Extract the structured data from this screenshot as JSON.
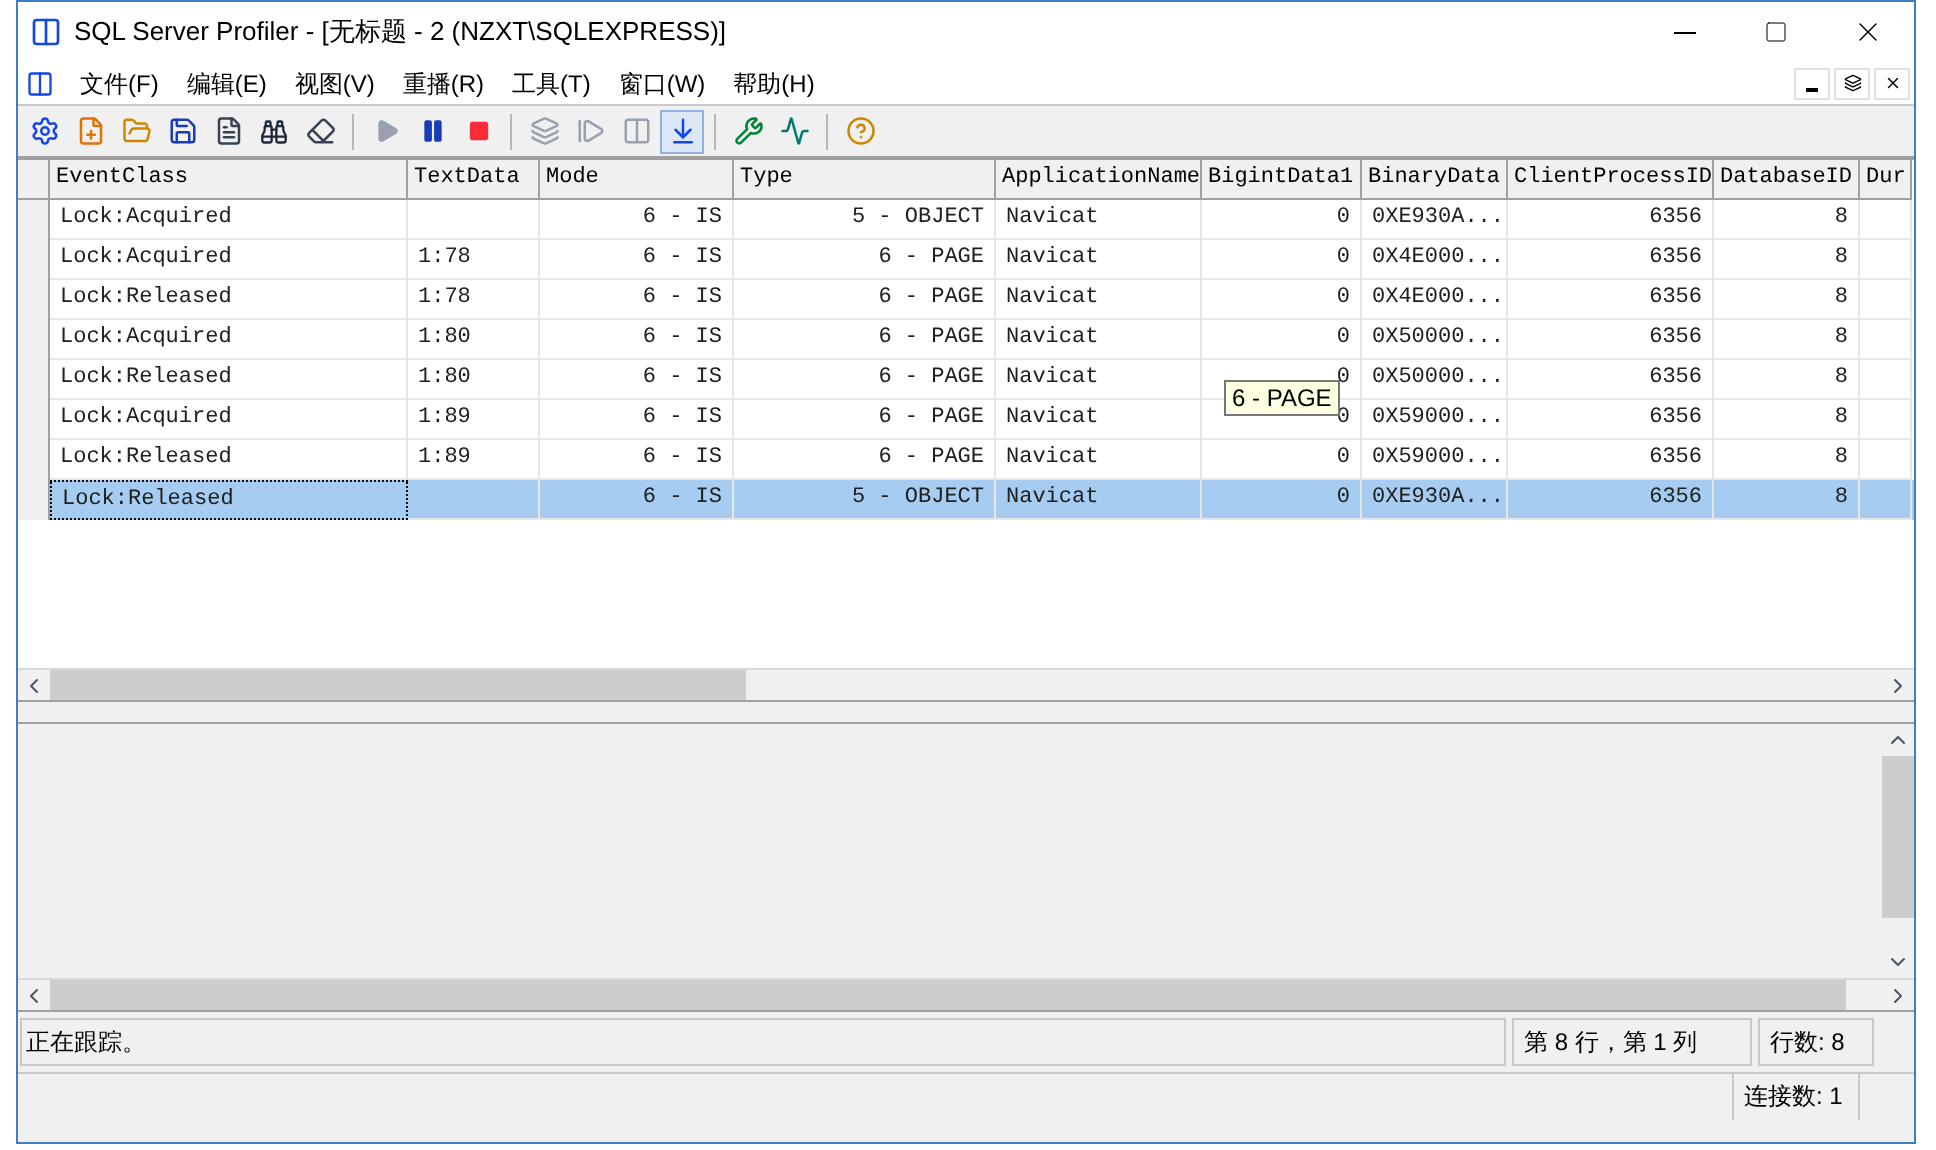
{
  "window": {
    "title": "SQL Server Profiler - [无标题 - 2 (NZXT\\SQLEXPRESS)]"
  },
  "menu": [
    "文件(F)",
    "编辑(E)",
    "视图(V)",
    "重播(R)",
    "工具(T)",
    "窗口(W)",
    "帮助(H)"
  ],
  "toolbar": [
    {
      "kind": "properties",
      "disabled": false,
      "selected": false
    },
    {
      "kind": "new",
      "disabled": false,
      "selected": false
    },
    {
      "kind": "open",
      "disabled": false,
      "selected": false
    },
    {
      "kind": "save",
      "disabled": false,
      "selected": false
    },
    {
      "kind": "template",
      "disabled": false,
      "selected": false
    },
    {
      "kind": "find",
      "disabled": false,
      "selected": false
    },
    {
      "kind": "clear",
      "disabled": false,
      "selected": false
    },
    {
      "kind": "sep"
    },
    {
      "kind": "play",
      "disabled": true,
      "selected": false
    },
    {
      "kind": "pause",
      "disabled": false,
      "selected": false
    },
    {
      "kind": "stop",
      "disabled": false,
      "selected": false
    },
    {
      "kind": "sep"
    },
    {
      "kind": "windows",
      "disabled": true,
      "selected": false
    },
    {
      "kind": "step",
      "disabled": true,
      "selected": false
    },
    {
      "kind": "run",
      "disabled": true,
      "selected": false
    },
    {
      "kind": "autoscroll",
      "disabled": false,
      "selected": true
    },
    {
      "kind": "sep"
    },
    {
      "kind": "tuning",
      "disabled": false,
      "selected": false
    },
    {
      "kind": "monitor",
      "disabled": false,
      "selected": false
    },
    {
      "kind": "sep"
    },
    {
      "kind": "help",
      "disabled": false,
      "selected": false
    }
  ],
  "table": {
    "columns": [
      "EventClass",
      "TextData",
      "Mode",
      "Type",
      "ApplicationName",
      "BigintData1",
      "BinaryData",
      "ClientProcessID",
      "DatabaseID",
      "Dur"
    ],
    "rows": [
      {
        "cells": [
          "Lock:Acquired",
          "",
          "6 - IS",
          "5 - OBJECT",
          "Navicat",
          "0",
          "0XE930A...",
          "6356",
          "8",
          ""
        ],
        "selected": false
      },
      {
        "cells": [
          "Lock:Acquired",
          "1:78",
          "6 - IS",
          "6 - PAGE",
          "Navicat",
          "0",
          "0X4E000...",
          "6356",
          "8",
          ""
        ],
        "selected": false
      },
      {
        "cells": [
          "Lock:Released",
          "1:78",
          "6 - IS",
          "6 - PAGE",
          "Navicat",
          "0",
          "0X4E000...",
          "6356",
          "8",
          ""
        ],
        "selected": false
      },
      {
        "cells": [
          "Lock:Acquired",
          "1:80",
          "6 - IS",
          "6 - PAGE",
          "Navicat",
          "0",
          "0X50000...",
          "6356",
          "8",
          ""
        ],
        "selected": false
      },
      {
        "cells": [
          "Lock:Released",
          "1:80",
          "6 - IS",
          "6 - PAGE",
          "Navicat",
          "0",
          "0X50000...",
          "6356",
          "8",
          ""
        ],
        "selected": false
      },
      {
        "cells": [
          "Lock:Acquired",
          "1:89",
          "6 - IS",
          "6 - PAGE",
          "Navicat",
          "0",
          "0X59000...",
          "6356",
          "8",
          ""
        ],
        "selected": false
      },
      {
        "cells": [
          "Lock:Released",
          "1:89",
          "6 - IS",
          "6 - PAGE",
          "Navicat",
          "0",
          "0X59000...",
          "6356",
          "8",
          ""
        ],
        "selected": false
      },
      {
        "cells": [
          "Lock:Released",
          "",
          "6 - IS",
          "5 - OBJECT",
          "Navicat",
          "0",
          "0XE930A...",
          "6356",
          "8",
          ""
        ],
        "selected": true
      }
    ]
  },
  "tooltip": "6 - PAGE",
  "status_bar": {
    "message": "正在跟踪。",
    "position": "第 8 行，第 1 列",
    "row_count": "行数: 8"
  },
  "connection_bar": {
    "connections": "连接数: 1"
  }
}
